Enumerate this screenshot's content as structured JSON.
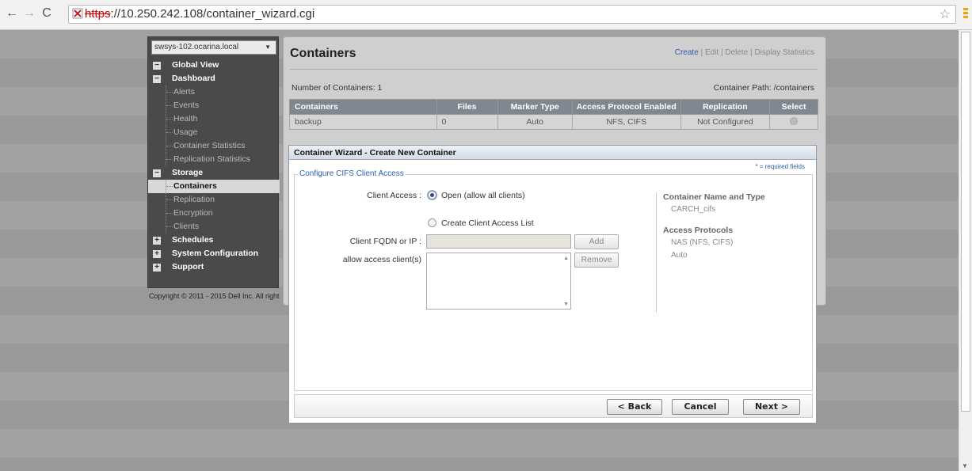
{
  "browser": {
    "url_scheme": "https",
    "url_rest": "://10.250.242.108/container_wizard.cgi",
    "back_icon": "back-arrow-icon",
    "forward_icon": "forward-arrow-icon",
    "reload_icon": "reload-icon"
  },
  "sidebar": {
    "host": "swsys-102.ocarina.local",
    "items": [
      {
        "label": "Global View",
        "type": "section",
        "box": "−"
      },
      {
        "label": "Dashboard",
        "type": "section",
        "box": "−"
      },
      {
        "label": "Alerts",
        "type": "sub"
      },
      {
        "label": "Events",
        "type": "sub"
      },
      {
        "label": "Health",
        "type": "sub"
      },
      {
        "label": "Usage",
        "type": "sub"
      },
      {
        "label": "Container Statistics",
        "type": "sub"
      },
      {
        "label": "Replication Statistics",
        "type": "sub"
      },
      {
        "label": "Storage",
        "type": "section",
        "box": "−"
      },
      {
        "label": "Containers",
        "type": "sub-active"
      },
      {
        "label": "Replication",
        "type": "sub"
      },
      {
        "label": "Encryption",
        "type": "sub"
      },
      {
        "label": "Clients",
        "type": "sub"
      },
      {
        "label": "Schedules",
        "type": "section",
        "box": "+"
      },
      {
        "label": "System Configuration",
        "type": "section",
        "box": "+"
      },
      {
        "label": "Support",
        "type": "section",
        "box": "+"
      }
    ],
    "copyright": "Copyright © 2011 - 2015 Dell Inc. All right"
  },
  "main": {
    "title": "Containers",
    "actions": {
      "create": "Create",
      "edit": "Edit",
      "delete": "Delete",
      "stats": "Display Statistics",
      "sep": "|"
    },
    "num_containers": "Number of Containers: 1",
    "container_path": "Container Path: /containers",
    "table": {
      "headers": [
        "Containers",
        "Files",
        "Marker Type",
        "Access Protocol Enabled",
        "Replication",
        "Select"
      ],
      "rows": [
        {
          "name": "backup",
          "files": "0",
          "marker": "Auto",
          "protocol": "NFS, CIFS",
          "replication": "Not Configured"
        }
      ]
    }
  },
  "wizard": {
    "title": "Container Wizard - Create New Container",
    "required_note": "* = required fields",
    "legend": "Configure CIFS Client Access",
    "client_access_label": "Client Access :",
    "option_open": "Open (allow all clients)",
    "option_list": "Create Client Access List",
    "fqdn_label": "Client FQDN or IP :",
    "fqdn_value": "",
    "add_button": "Add",
    "allow_label": "allow access client(s)",
    "remove_button": "Remove",
    "info": {
      "name_type_title": "Container Name and Type",
      "name_type_value": "CARCH_cifs",
      "protocols_title": "Access Protocols",
      "protocols_value": "NAS (NFS, CIFS)",
      "marker_value": "Auto"
    },
    "back_button": "< Back",
    "cancel_button": "Cancel",
    "next_button": "Next >"
  }
}
